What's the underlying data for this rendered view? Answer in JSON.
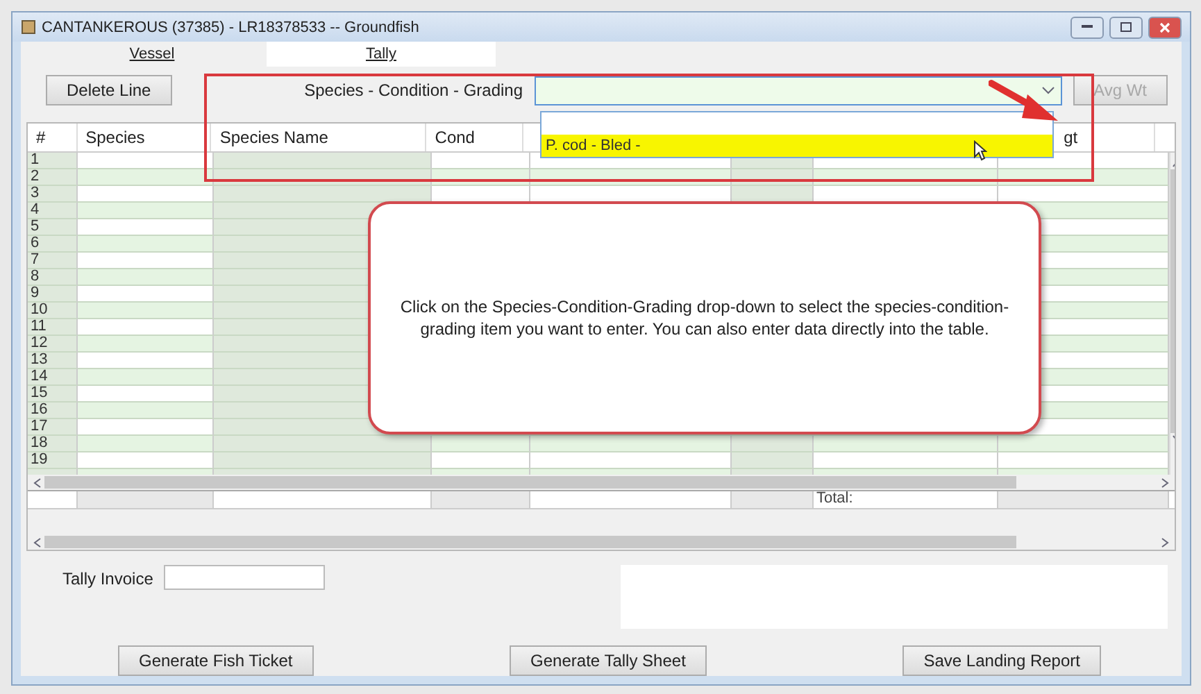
{
  "window": {
    "title": "CANTANKEROUS (37385) - LR18378533 -- Groundfish"
  },
  "tabs": [
    {
      "label": "Vessel",
      "selected": false
    },
    {
      "label": "Tally",
      "selected": true
    }
  ],
  "toolbar": {
    "delete_button": "Delete Line",
    "combo_label": "Species - Condition - Grading",
    "combo": {
      "expanded": true,
      "options": [
        {
          "label": "P. cod - Bled -",
          "selected": true
        }
      ]
    },
    "avg_button": {
      "label": "Avg Wt",
      "disabled": true
    }
  },
  "table": {
    "columns": [
      {
        "label": "#"
      },
      {
        "label": "Species"
      },
      {
        "label": "Species Name"
      },
      {
        "label": "Cond"
      },
      {
        "label": "gt"
      }
    ],
    "rows": [
      {
        "number": "1"
      },
      {
        "number": "2"
      },
      {
        "number": "3"
      },
      {
        "number": "4"
      },
      {
        "number": "5"
      },
      {
        "number": "6"
      },
      {
        "number": "7"
      },
      {
        "number": "8"
      },
      {
        "number": "9"
      },
      {
        "number": "10"
      },
      {
        "number": "11"
      },
      {
        "number": "12"
      },
      {
        "number": "13"
      },
      {
        "number": "14"
      },
      {
        "number": "15"
      },
      {
        "number": "16"
      },
      {
        "number": "17"
      },
      {
        "number": "18"
      },
      {
        "number": "19"
      }
    ],
    "total_label": "Total:"
  },
  "tally_invoice": {
    "label": "Tally Invoice"
  },
  "buttons": [
    "Generate Fish Ticket",
    "Generate Tally Sheet",
    "Save Landing Report"
  ],
  "annotation": {
    "callout": "Click on the Species-Condition-Grading drop-down to select the species-condition-grading item you want to enter. You can also enter data directly into the table."
  }
}
